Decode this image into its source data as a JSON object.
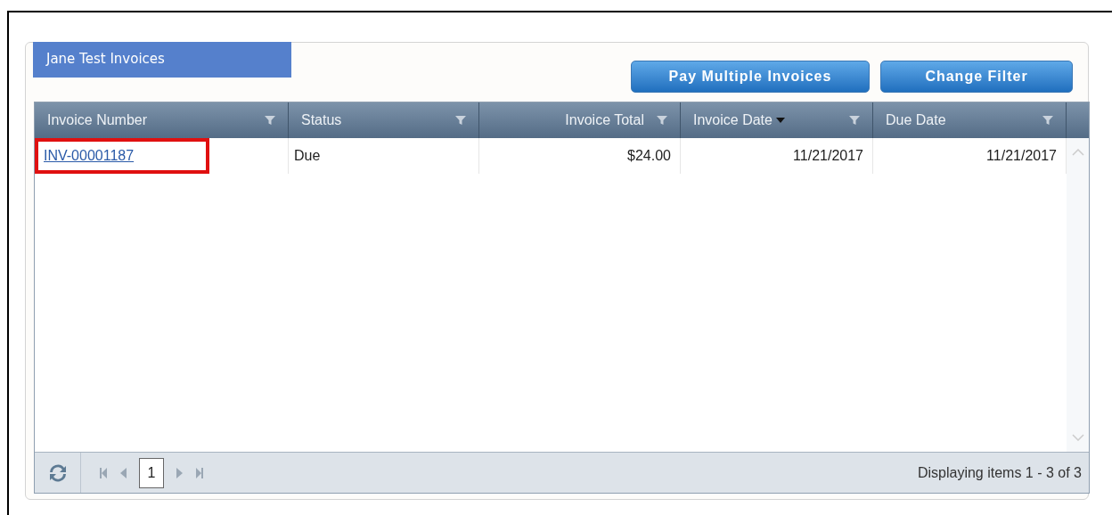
{
  "panel": {
    "title": "Jane Test Invoices"
  },
  "toolbar": {
    "buttons": [
      "Pay Multiple Invoices",
      "Change Filter"
    ]
  },
  "table": {
    "columns": [
      {
        "label": "Invoice Number",
        "sorted": false
      },
      {
        "label": "Status",
        "sorted": false
      },
      {
        "label": "Invoice Total",
        "sorted": false
      },
      {
        "label": "Invoice Date",
        "sorted": true
      },
      {
        "label": "Due Date",
        "sorted": false
      }
    ],
    "rows": [
      {
        "cells": [
          {
            "text": "INV-00001187",
            "kind": "link",
            "highlighted": true
          },
          {
            "text": "Due",
            "kind": "text",
            "highlighted": false
          },
          {
            "text": "$24.00",
            "kind": "text",
            "highlighted": false
          },
          {
            "text": "11/21/2017",
            "kind": "text",
            "highlighted": false
          },
          {
            "text": "11/21/2017",
            "kind": "text",
            "highlighted": false
          }
        ]
      }
    ]
  },
  "pager": {
    "page": "1",
    "summary": "Displaying items 1 - 3 of 3"
  }
}
